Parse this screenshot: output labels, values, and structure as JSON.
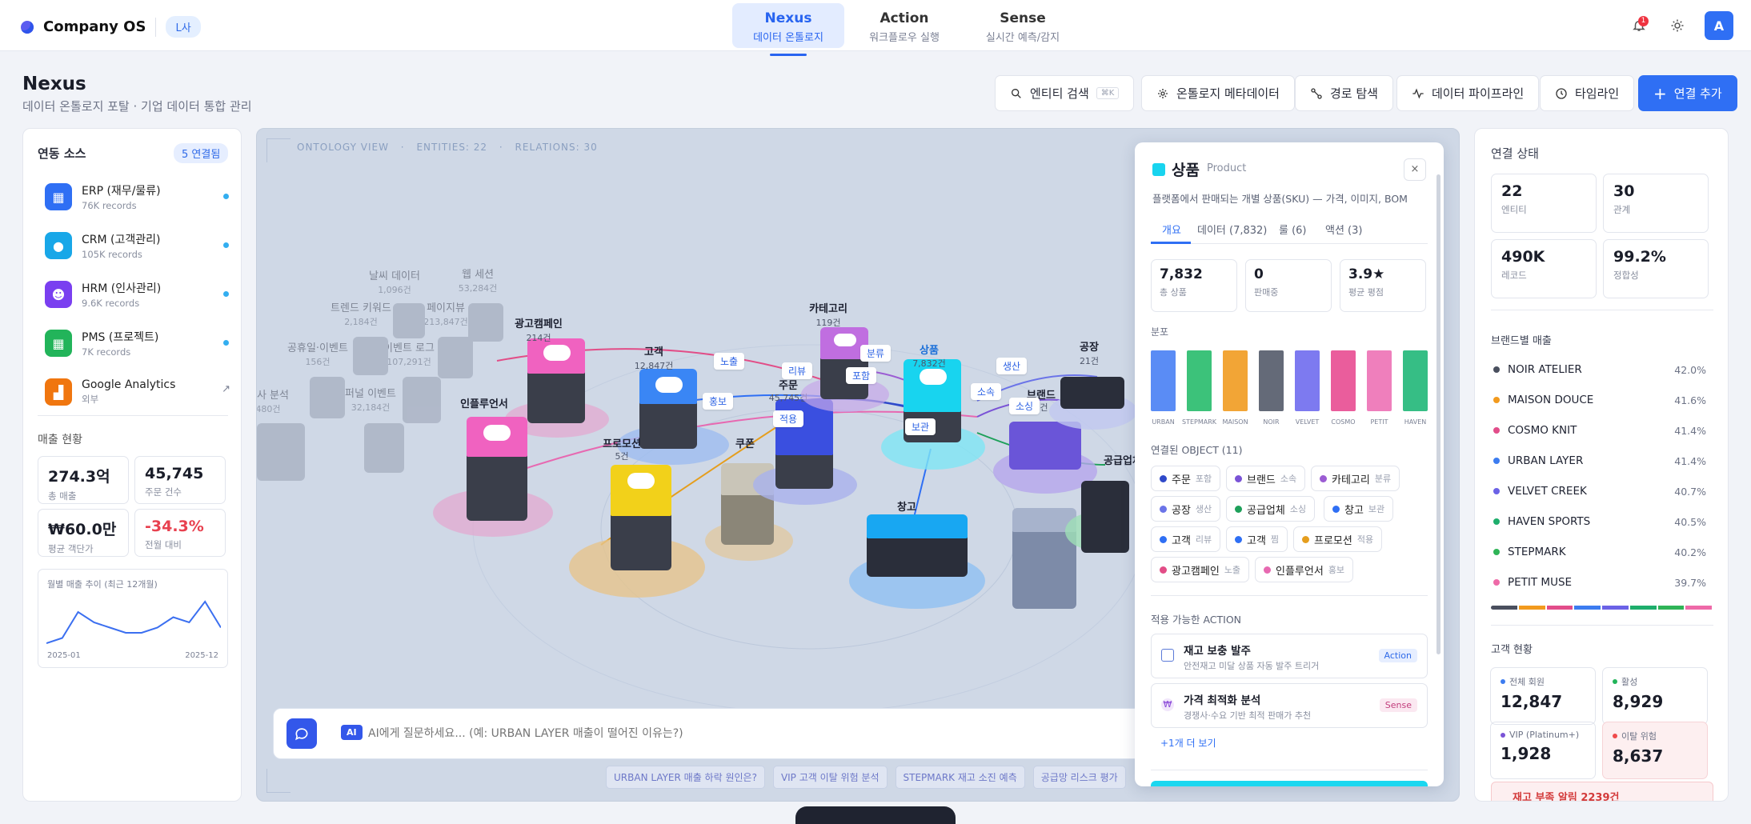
{
  "app": {
    "name": "Company OS",
    "tenant": "L사"
  },
  "nav": [
    {
      "title": "Nexus",
      "sub": "데이터 온톨로지"
    },
    {
      "title": "Action",
      "sub": "워크플로우 실행"
    },
    {
      "title": "Sense",
      "sub": "실시간 예측/감지"
    }
  ],
  "topbar": {
    "notif_count": "1",
    "avatar": "A"
  },
  "page": {
    "title": "Nexus",
    "subtitle": "데이터 온톨로지 포탈 · 기업 데이터 통합 관리"
  },
  "toolbar": {
    "search": "엔티티 검색",
    "search_kbd": "⌘K",
    "meta": "온톨로지 메타데이터",
    "path": "경로 탐색",
    "pipeline": "데이터 파이프라인",
    "timeline": "타임라인",
    "add": "연결 추가"
  },
  "sources": {
    "title": "연동 소스",
    "count": "5 연결됨",
    "items": [
      {
        "name": "ERP (재무/물류)",
        "records": "76K records",
        "color": "#2f6ff4",
        "icon": "grid-icon"
      },
      {
        "name": "CRM (고객관리)",
        "records": "105K records",
        "color": "#18a7e8",
        "icon": "chat-icon"
      },
      {
        "name": "HRM (인사관리)",
        "records": "9.6K records",
        "color": "#7a3ff0",
        "icon": "user-icon"
      },
      {
        "name": "PMS (프로젝트)",
        "records": "7K records",
        "color": "#22b45a",
        "icon": "grid-icon"
      },
      {
        "name": "Google Analytics",
        "records": "외부",
        "color": "#f0760f",
        "icon": "chart-icon"
      }
    ]
  },
  "sales": {
    "title": "매출 현황",
    "stats": [
      {
        "value": "274.3억",
        "label": "총 매출"
      },
      {
        "value": "45,745",
        "label": "주문 건수"
      },
      {
        "value": "₩60.0만",
        "label": "평균 객단가"
      },
      {
        "value": "-34.3%",
        "label": "전월 대비"
      }
    ],
    "trend_title": "월별 매출 추이 (최근 12개월)",
    "trend_start": "2025-01",
    "trend_end": "2025-12",
    "trend": [
      3,
      4,
      9,
      7,
      6,
      5,
      5,
      6,
      8,
      7,
      11,
      6
    ]
  },
  "graph": {
    "view": "ONTOLOGY VIEW",
    "entities": "ENTITIES: 22",
    "relations": "RELATIONS: 30",
    "nodes": {
      "ad": {
        "name": "광고캠페인",
        "sub": "214건"
      },
      "influencer": {
        "name": "인플루언서"
      },
      "customer": {
        "name": "고객",
        "sub": "12,847건"
      },
      "promo": {
        "name": "프로모션",
        "sub": "5건"
      },
      "coupon": {
        "name": "쿠폰"
      },
      "order": {
        "name": "주문",
        "sub": "45,745건"
      },
      "category": {
        "name": "카테고리",
        "sub": "119건"
      },
      "product": {
        "name": "상품",
        "sub": "7,832건"
      },
      "warehouse": {
        "name": "창고"
      },
      "brand": {
        "name": "브랜드",
        "sub": "8건"
      },
      "factory": {
        "name": "공장",
        "sub": "21건"
      },
      "supplier": {
        "name": "공급업체"
      }
    },
    "ghosts": [
      {
        "name": "날씨 데이터",
        "sub": "1,096건"
      },
      {
        "name": "웹 세션",
        "sub": "53,284건"
      },
      {
        "name": "트렌드 키워드",
        "sub": "2,184건"
      },
      {
        "name": "페이지뷰",
        "sub": "213,847건"
      },
      {
        "name": "공휴일·이벤트",
        "sub": "156건"
      },
      {
        "name": "이벤트 로그",
        "sub": "107,291건"
      },
      {
        "name": "퍼널 이벤트",
        "sub": "32,184건"
      },
      {
        "name": "상사 분석",
        "sub": "480건"
      }
    ],
    "edges": [
      "노출",
      "홍보",
      "적용",
      "리뷰",
      "분류",
      "포함",
      "보관",
      "소속",
      "소싱",
      "생산"
    ],
    "ai_placeholder": "AI에게 질문하세요... (예: URBAN LAYER 매출이 떨어진 이유는?)",
    "ai_badge": "AI",
    "chips": [
      "URBAN LAYER 매출 하락 원인은?",
      "VIP 고객 이탈 위험 분석",
      "STEPMARK 재고 소진 예측",
      "공급망 리스크 평가"
    ]
  },
  "detail": {
    "title": "상품",
    "en": "Product",
    "desc": "플랫폼에서 판매되는 개별 상품(SKU) — 가격, 이미지, BOM",
    "tabs": [
      "개요",
      "데이터 (7,832)",
      "룰 (6)",
      "액션 (3)"
    ],
    "stats": [
      {
        "value": "7,832",
        "label": "총 상품"
      },
      {
        "value": "0",
        "label": "판매중"
      },
      {
        "value": "3.9★",
        "label": "평균 평점"
      }
    ],
    "dist_title": "분포",
    "dist": [
      {
        "label": "URBAN",
        "color": "#5a8cf5",
        "value": 1
      },
      {
        "label": "STEPMARK",
        "color": "#3cc27a",
        "value": 1
      },
      {
        "label": "MAISON",
        "color": "#f2a536",
        "value": 1
      },
      {
        "label": "NOIR",
        "color": "#646a78",
        "value": 1
      },
      {
        "label": "VELVET",
        "color": "#7d7af0",
        "value": 1
      },
      {
        "label": "COSMO",
        "color": "#ea5d9c",
        "value": 1
      },
      {
        "label": "PETIT",
        "color": "#ef7fbc",
        "value": 1
      },
      {
        "label": "HAVEN",
        "color": "#36be85",
        "value": 1
      }
    ],
    "linked_title": "연결된 OBJECT (11)",
    "linked": [
      {
        "name": "주문",
        "rel": "포함",
        "color": "#2f49c9"
      },
      {
        "name": "브랜드",
        "rel": "소속",
        "color": "#7a53d6"
      },
      {
        "name": "카테고리",
        "rel": "분류",
        "color": "#9b5cd3"
      },
      {
        "name": "공장",
        "rel": "생산",
        "color": "#6b74e8"
      },
      {
        "name": "공급업체",
        "rel": "소싱",
        "color": "#1ea05a"
      },
      {
        "name": "창고",
        "rel": "보관",
        "color": "#2f6ff4"
      },
      {
        "name": "고객",
        "rel": "리뷰",
        "color": "#2f6ff4"
      },
      {
        "name": "고객",
        "rel": "찜",
        "color": "#2f6ff4"
      },
      {
        "name": "프로모션",
        "rel": "적용",
        "color": "#e59e1e"
      },
      {
        "name": "광고캠페인",
        "rel": "노출",
        "color": "#e24d87"
      },
      {
        "name": "인플루언서",
        "rel": "홍보",
        "color": "#e769b1"
      }
    ],
    "actions_title": "적용 가능한 ACTION",
    "actions": [
      {
        "name": "재고 보충 발주",
        "desc": "안전재고 미달 상품 자동 발주 트리거",
        "badge": "Action"
      },
      {
        "name": "가격 최적화 분석",
        "desc": "경쟁사·수요 기반 최적 판매가 추천",
        "badge": "Sense"
      }
    ],
    "more": "+1개 더 보기"
  },
  "status": {
    "title": "연결 상태",
    "stats": [
      {
        "value": "22",
        "label": "엔티티"
      },
      {
        "value": "30",
        "label": "관계"
      },
      {
        "value": "490K",
        "label": "레코드"
      },
      {
        "value": "99.2%",
        "label": "정합성"
      }
    ],
    "brand_title": "브랜드별 매출",
    "brands": [
      {
        "name": "NOIR ATELIER",
        "pct": "42.0%",
        "color": "#4a4f5e"
      },
      {
        "name": "MAISON DOUCE",
        "pct": "41.6%",
        "color": "#f29a1e"
      },
      {
        "name": "COSMO KNIT",
        "pct": "41.4%",
        "color": "#e24d8a"
      },
      {
        "name": "URBAN LAYER",
        "pct": "41.4%",
        "color": "#3c7cf0"
      },
      {
        "name": "VELVET CREEK",
        "pct": "40.7%",
        "color": "#6b62e6"
      },
      {
        "name": "HAVEN SPORTS",
        "pct": "40.5%",
        "color": "#1eae6c"
      },
      {
        "name": "STEPMARK",
        "pct": "40.2%",
        "color": "#2fb457"
      },
      {
        "name": "PETIT MUSE",
        "pct": "39.7%",
        "color": "#ee6aa8"
      }
    ],
    "cust_title": "고객 현황",
    "cust": [
      {
        "label": "전체 회원",
        "value": "12,847",
        "color": "#3c7cf0",
        "bg": "#fff"
      },
      {
        "label": "활성",
        "value": "8,929",
        "color": "#22b45a",
        "bg": "#fff"
      },
      {
        "label": "VIP (Platinum+)",
        "value": "1,928",
        "color": "#7a53d6",
        "bg": "#fff"
      },
      {
        "label": "이탈 위험",
        "value": "8,637",
        "color": "#ef4b4b",
        "bg": "#fdeff0"
      }
    ],
    "alert": "재고 부족 알림 2239건"
  }
}
